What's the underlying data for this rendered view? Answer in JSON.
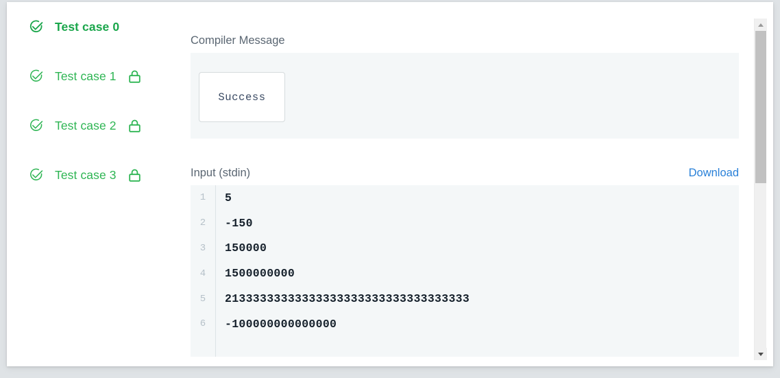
{
  "testcases": {
    "items": [
      {
        "label": "Test case 0",
        "status_icon": "check-circle-icon",
        "locked": false,
        "active": true
      },
      {
        "label": "Test case 1",
        "status_icon": "check-circle-icon",
        "locked": true,
        "active": false
      },
      {
        "label": "Test case 2",
        "status_icon": "check-circle-icon",
        "locked": true,
        "active": false
      },
      {
        "label": "Test case 3",
        "status_icon": "check-circle-icon",
        "locked": true,
        "active": false
      }
    ],
    "lock_icon": "lock-icon",
    "accent_color": "#2eb553",
    "active_color": "#1aa64b"
  },
  "compiler": {
    "section_label": "Compiler Message",
    "message": "Success",
    "panel_bg": "#f4f7f8",
    "chip_bg": "#ffffff",
    "chip_border": "#d5dbdd"
  },
  "input": {
    "section_label": "Input (stdin)",
    "download_label": "Download",
    "download_color": "#2980d8",
    "panel_bg": "#f4f7f8",
    "lines": [
      {
        "number": "1",
        "text": "5"
      },
      {
        "number": "2",
        "text": "-150"
      },
      {
        "number": "3",
        "text": "150000"
      },
      {
        "number": "4",
        "text": "1500000000"
      },
      {
        "number": "5",
        "text": "21333333333333333333333333333333333"
      },
      {
        "number": "6",
        "text": "-100000000000000"
      }
    ]
  },
  "scrollbar": {
    "up_arrow_icon": "chevron-up-icon",
    "down_arrow_icon": "chevron-down-icon",
    "thumb_color": "#c1c1c1",
    "track_color": "#f0f0f0"
  }
}
